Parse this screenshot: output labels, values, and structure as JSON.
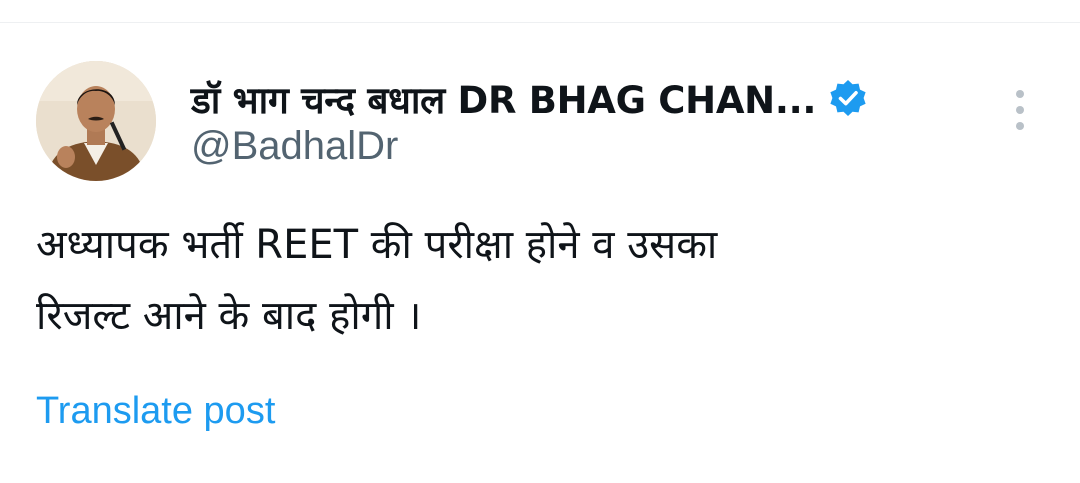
{
  "author": {
    "display_name": "डॉ भाग चन्द बधाल DR BHAG CHAN...",
    "handle": "@BadhalDr",
    "verified": true,
    "verified_badge_color": "#1d9bf0",
    "avatar_icon": "profile-photo"
  },
  "post": {
    "text_line_1": "अध्यापक भर्ती REET की परीक्षा होने व उसका",
    "text_line_2": "रिजल्ट आने के बाद होगी ।"
  },
  "actions": {
    "translate_label": "Translate post",
    "more_icon": "more-vertical-icon"
  },
  "colors": {
    "text_primary": "#0f1419",
    "text_secondary": "#536471",
    "link": "#1d9bf0"
  }
}
